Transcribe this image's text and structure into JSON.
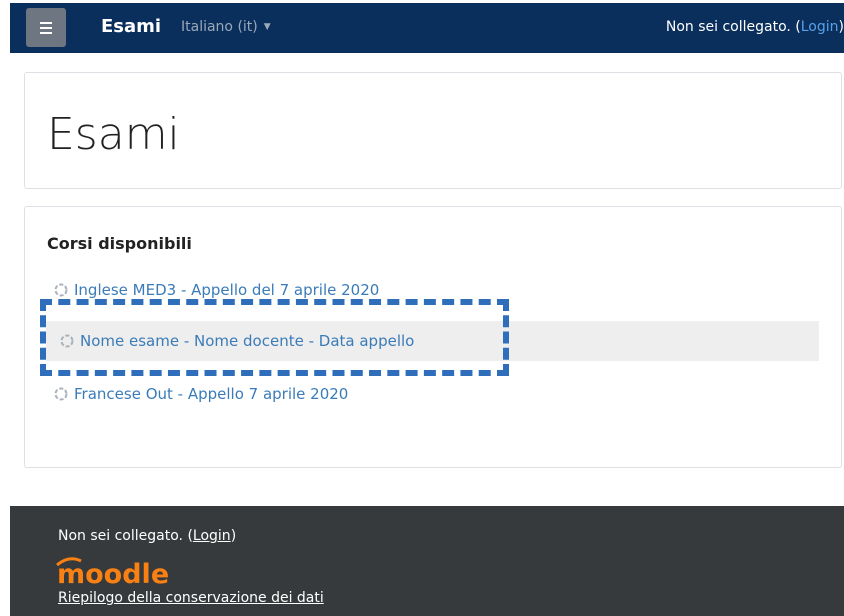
{
  "navbar": {
    "brand": "Esami",
    "language": "Italiano (it)",
    "login_prefix": "Non sei collegato. (",
    "login_link": "Login",
    "login_suffix": ")"
  },
  "header": {
    "title": "Esami"
  },
  "courses": {
    "title": "Corsi disponibili",
    "items": [
      {
        "label": "Inglese MED3 - Appello del 7 aprile 2020"
      },
      {
        "label": "Nome esame - Nome docente - Data appello"
      },
      {
        "label": "Francese Out - Appello 7 aprile 2020"
      }
    ]
  },
  "footer": {
    "login_prefix": "Non sei collegato. (",
    "login_link": "Login",
    "login_suffix": ")",
    "logo_text": "moodle",
    "data_retention_link": "Riepilogo della conservazione dei dati"
  },
  "colors": {
    "navbar_bg": "#0a2f5c",
    "link": "#3a7bb8",
    "footer_bg": "#373a3c",
    "logo_orange": "#f98012",
    "highlight_dash": "#2f6eba"
  }
}
